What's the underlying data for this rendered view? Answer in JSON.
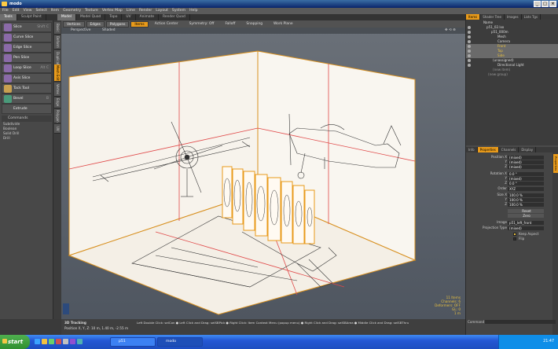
{
  "window": {
    "title": "modo"
  },
  "menubar": [
    "File",
    "Edit",
    "View",
    "Select",
    "Item",
    "Geometry",
    "Texture",
    "Vertex Map",
    "Lime",
    "Render",
    "Layout",
    "System",
    "Help"
  ],
  "tabs": [
    {
      "label": "Tools",
      "active": true
    },
    {
      "label": "Sculpt Paint",
      "active": false
    },
    {
      "label": "Model",
      "active": true
    },
    {
      "label": "Model Quad",
      "active": false
    },
    {
      "label": "Topo",
      "active": false
    },
    {
      "label": "UV",
      "active": false
    },
    {
      "label": "Animate",
      "active": false
    },
    {
      "label": "Render Quad",
      "active": false
    }
  ],
  "toolbox": {
    "tools": [
      {
        "label": "Slice",
        "shortcut": "Shift C"
      },
      {
        "label": "Curve Slice",
        "shortcut": ""
      },
      {
        "label": "Edge Slice",
        "shortcut": ""
      },
      {
        "label": "Pen Slice",
        "shortcut": ""
      },
      {
        "label": "Loop Slice",
        "shortcut": "Alt C"
      },
      {
        "label": "Axis Slice",
        "shortcut": ""
      },
      {
        "label": "Tack Tool",
        "shortcut": ""
      },
      {
        "label": "Bevel",
        "shortcut": "B"
      }
    ],
    "extrude_label": "Extrude",
    "commands_label": "Commands",
    "commands": [
      "Subdivide",
      "Boolean",
      "Solid Drill",
      "Drill"
    ]
  },
  "vtabs": [
    "Basic",
    "Deform",
    "Duplicate",
    "Mesh Edit",
    "Vertex",
    "Edge",
    "Polygon",
    "UV"
  ],
  "modebar": {
    "buttons": [
      {
        "label": "Vertices",
        "selected": false
      },
      {
        "label": "Edges",
        "selected": false
      },
      {
        "label": "Polygons",
        "selected": false
      },
      {
        "label": "Items",
        "selected": true
      }
    ],
    "dropdowns": [
      "Action Center",
      "Symmetry: Off",
      "Falloff",
      "Snapping",
      "Work Plane"
    ]
  },
  "viewport": {
    "view_label": "Perspective",
    "shading_label": "Shaded",
    "info": [
      "11 Items",
      "Channels: 6",
      "Deformers: OFF",
      "GL: 0",
      "1 m"
    ]
  },
  "status": {
    "mode": "3D Tracking",
    "position": "Position X, Y, Z:  10 m, 1.40 m, -2.55 m",
    "hint": "Left Double Click: selCon ● Left Click and Drag: selSBPick ● Right Click: Item Context Menu (popup menu) ● Right Click and Drag: selSBArea ● Middle Click and Drag: selSBThru"
  },
  "right_panel": {
    "top_tabs": [
      {
        "label": "Items",
        "active": true
      },
      {
        "label": "Shader Tree",
        "active": false
      },
      {
        "label": "Images",
        "active": false
      },
      {
        "label": "Lists Tgs",
        "active": false
      }
    ],
    "tree": [
      {
        "label": "Name",
        "indent": 2,
        "sel": false
      },
      {
        "label": "p51_02.lxo",
        "indent": 8,
        "sel": false
      },
      {
        "label": "p51_000m",
        "indent": 14,
        "sel": false
      },
      {
        "label": "Mesh",
        "indent": 22,
        "sel": false
      },
      {
        "label": "Camera",
        "indent": 22,
        "sel": false
      },
      {
        "label": "Front",
        "indent": 22,
        "sel": true
      },
      {
        "label": "Top",
        "indent": 22,
        "sel": true
      },
      {
        "label": "Side",
        "indent": 22,
        "sel": true
      },
      {
        "label": "(unassigned)",
        "indent": 16,
        "sel": false
      },
      {
        "label": "Directional Light",
        "indent": 22,
        "sel": false
      },
      {
        "label": "(new item)",
        "indent": 16,
        "sel": false
      },
      {
        "label": "(new group)",
        "indent": 10,
        "sel": false
      }
    ],
    "prop_tabs": [
      {
        "label": "Info",
        "active": false
      },
      {
        "label": "Properties",
        "active": true
      },
      {
        "label": "Channels",
        "active": false
      },
      {
        "label": "Display",
        "active": false
      }
    ],
    "properties": [
      {
        "label": "Position X",
        "value": "(mixed)"
      },
      {
        "label": "Y",
        "value": "(mixed)"
      },
      {
        "label": "Z",
        "value": "(mixed)"
      },
      {
        "label": "Rotation X",
        "value": "0.0 °"
      },
      {
        "label": "Y",
        "value": "(mixed)"
      },
      {
        "label": "Z",
        "value": "0.0 °"
      },
      {
        "label": "Order",
        "value": "XYZ"
      },
      {
        "label": "Size X",
        "value": "100.0 %"
      },
      {
        "label": "Y",
        "value": "100.0 %"
      },
      {
        "label": "Z",
        "value": "100.0 %"
      },
      {
        "label": "",
        "value": "Reset"
      },
      {
        "label": "",
        "value": "Zero"
      },
      {
        "label": "Image",
        "value": "p51_left_front"
      },
      {
        "label": "Projection Type",
        "value": "(mixed)"
      }
    ],
    "checks": [
      "Keep Aspect",
      "Flip"
    ],
    "properties_tag": "Properties",
    "command_label": "Command"
  },
  "taskbar": {
    "start_label": "start",
    "items": [
      {
        "label": "p51",
        "active": false
      },
      {
        "label": "modo",
        "active": true
      }
    ],
    "clock": "21:47"
  }
}
